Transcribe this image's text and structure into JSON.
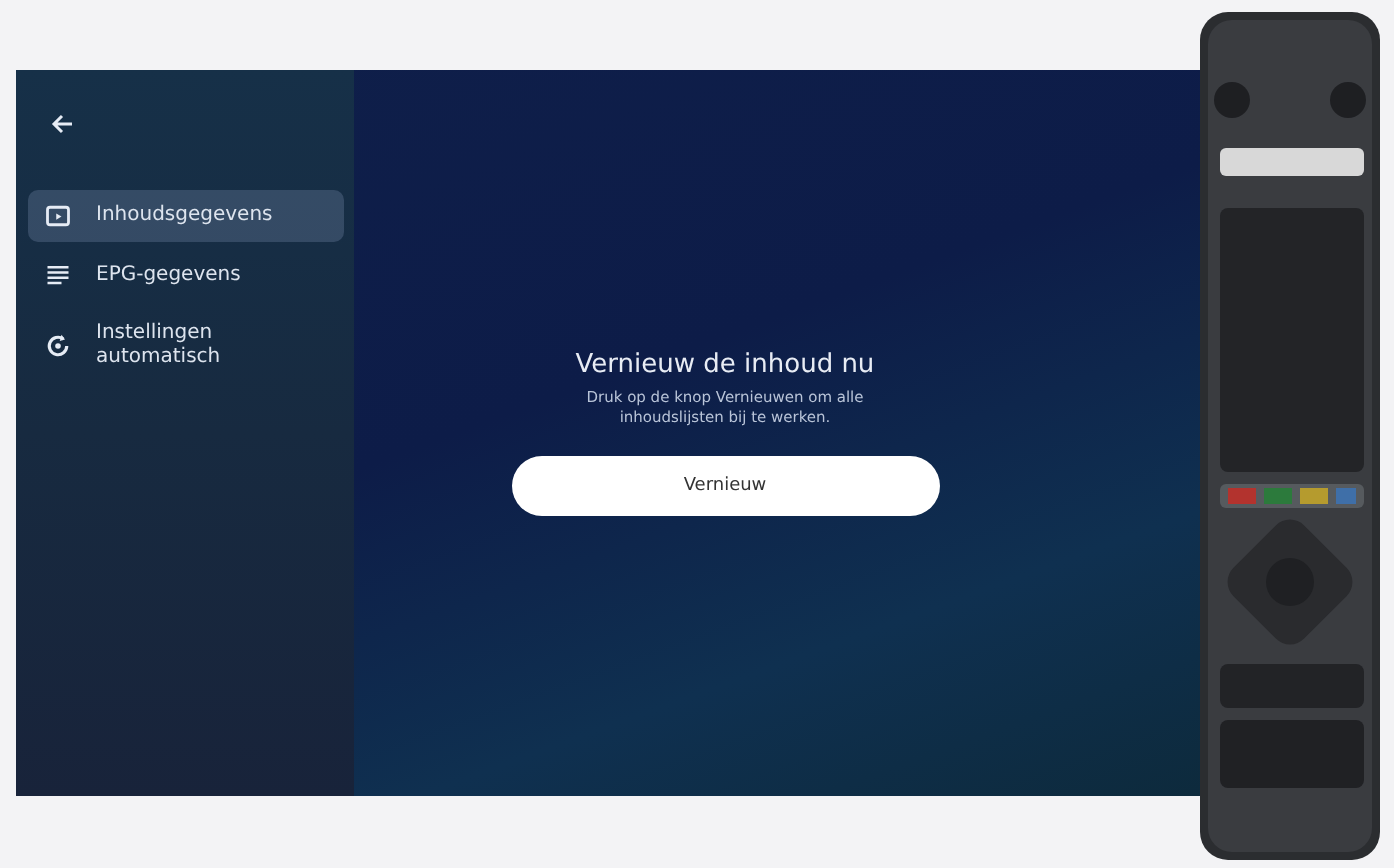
{
  "sidebar": {
    "items": [
      {
        "label": "Inhoudsgegevens",
        "kind": "folder",
        "selected": true
      },
      {
        "label": "EPG-gegevens",
        "kind": "list",
        "selected": false
      },
      {
        "label": "Instellingen automatisch",
        "kind": "refresh",
        "selected": false
      }
    ]
  },
  "content": {
    "title": "Vernieuw de inhoud nu",
    "description": "Druk op de knop Vernieuwen om alle inhoudslijsten bij te werken.",
    "button": "Vernieuw"
  }
}
